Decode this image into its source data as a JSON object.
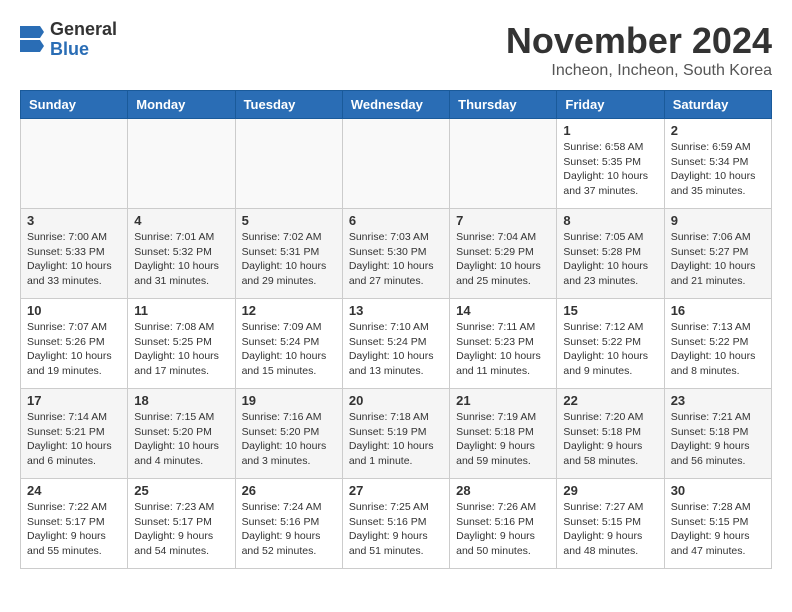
{
  "logo": {
    "general": "General",
    "blue": "Blue"
  },
  "title": "November 2024",
  "location": "Incheon, Incheon, South Korea",
  "headers": [
    "Sunday",
    "Monday",
    "Tuesday",
    "Wednesday",
    "Thursday",
    "Friday",
    "Saturday"
  ],
  "weeks": [
    [
      {
        "day": "",
        "info": ""
      },
      {
        "day": "",
        "info": ""
      },
      {
        "day": "",
        "info": ""
      },
      {
        "day": "",
        "info": ""
      },
      {
        "day": "",
        "info": ""
      },
      {
        "day": "1",
        "info": "Sunrise: 6:58 AM\nSunset: 5:35 PM\nDaylight: 10 hours\nand 37 minutes."
      },
      {
        "day": "2",
        "info": "Sunrise: 6:59 AM\nSunset: 5:34 PM\nDaylight: 10 hours\nand 35 minutes."
      }
    ],
    [
      {
        "day": "3",
        "info": "Sunrise: 7:00 AM\nSunset: 5:33 PM\nDaylight: 10 hours\nand 33 minutes."
      },
      {
        "day": "4",
        "info": "Sunrise: 7:01 AM\nSunset: 5:32 PM\nDaylight: 10 hours\nand 31 minutes."
      },
      {
        "day": "5",
        "info": "Sunrise: 7:02 AM\nSunset: 5:31 PM\nDaylight: 10 hours\nand 29 minutes."
      },
      {
        "day": "6",
        "info": "Sunrise: 7:03 AM\nSunset: 5:30 PM\nDaylight: 10 hours\nand 27 minutes."
      },
      {
        "day": "7",
        "info": "Sunrise: 7:04 AM\nSunset: 5:29 PM\nDaylight: 10 hours\nand 25 minutes."
      },
      {
        "day": "8",
        "info": "Sunrise: 7:05 AM\nSunset: 5:28 PM\nDaylight: 10 hours\nand 23 minutes."
      },
      {
        "day": "9",
        "info": "Sunrise: 7:06 AM\nSunset: 5:27 PM\nDaylight: 10 hours\nand 21 minutes."
      }
    ],
    [
      {
        "day": "10",
        "info": "Sunrise: 7:07 AM\nSunset: 5:26 PM\nDaylight: 10 hours\nand 19 minutes."
      },
      {
        "day": "11",
        "info": "Sunrise: 7:08 AM\nSunset: 5:25 PM\nDaylight: 10 hours\nand 17 minutes."
      },
      {
        "day": "12",
        "info": "Sunrise: 7:09 AM\nSunset: 5:24 PM\nDaylight: 10 hours\nand 15 minutes."
      },
      {
        "day": "13",
        "info": "Sunrise: 7:10 AM\nSunset: 5:24 PM\nDaylight: 10 hours\nand 13 minutes."
      },
      {
        "day": "14",
        "info": "Sunrise: 7:11 AM\nSunset: 5:23 PM\nDaylight: 10 hours\nand 11 minutes."
      },
      {
        "day": "15",
        "info": "Sunrise: 7:12 AM\nSunset: 5:22 PM\nDaylight: 10 hours\nand 9 minutes."
      },
      {
        "day": "16",
        "info": "Sunrise: 7:13 AM\nSunset: 5:22 PM\nDaylight: 10 hours\nand 8 minutes."
      }
    ],
    [
      {
        "day": "17",
        "info": "Sunrise: 7:14 AM\nSunset: 5:21 PM\nDaylight: 10 hours\nand 6 minutes."
      },
      {
        "day": "18",
        "info": "Sunrise: 7:15 AM\nSunset: 5:20 PM\nDaylight: 10 hours\nand 4 minutes."
      },
      {
        "day": "19",
        "info": "Sunrise: 7:16 AM\nSunset: 5:20 PM\nDaylight: 10 hours\nand 3 minutes."
      },
      {
        "day": "20",
        "info": "Sunrise: 7:18 AM\nSunset: 5:19 PM\nDaylight: 10 hours\nand 1 minute."
      },
      {
        "day": "21",
        "info": "Sunrise: 7:19 AM\nSunset: 5:18 PM\nDaylight: 9 hours\nand 59 minutes."
      },
      {
        "day": "22",
        "info": "Sunrise: 7:20 AM\nSunset: 5:18 PM\nDaylight: 9 hours\nand 58 minutes."
      },
      {
        "day": "23",
        "info": "Sunrise: 7:21 AM\nSunset: 5:18 PM\nDaylight: 9 hours\nand 56 minutes."
      }
    ],
    [
      {
        "day": "24",
        "info": "Sunrise: 7:22 AM\nSunset: 5:17 PM\nDaylight: 9 hours\nand 55 minutes."
      },
      {
        "day": "25",
        "info": "Sunrise: 7:23 AM\nSunset: 5:17 PM\nDaylight: 9 hours\nand 54 minutes."
      },
      {
        "day": "26",
        "info": "Sunrise: 7:24 AM\nSunset: 5:16 PM\nDaylight: 9 hours\nand 52 minutes."
      },
      {
        "day": "27",
        "info": "Sunrise: 7:25 AM\nSunset: 5:16 PM\nDaylight: 9 hours\nand 51 minutes."
      },
      {
        "day": "28",
        "info": "Sunrise: 7:26 AM\nSunset: 5:16 PM\nDaylight: 9 hours\nand 50 minutes."
      },
      {
        "day": "29",
        "info": "Sunrise: 7:27 AM\nSunset: 5:15 PM\nDaylight: 9 hours\nand 48 minutes."
      },
      {
        "day": "30",
        "info": "Sunrise: 7:28 AM\nSunset: 5:15 PM\nDaylight: 9 hours\nand 47 minutes."
      }
    ]
  ]
}
